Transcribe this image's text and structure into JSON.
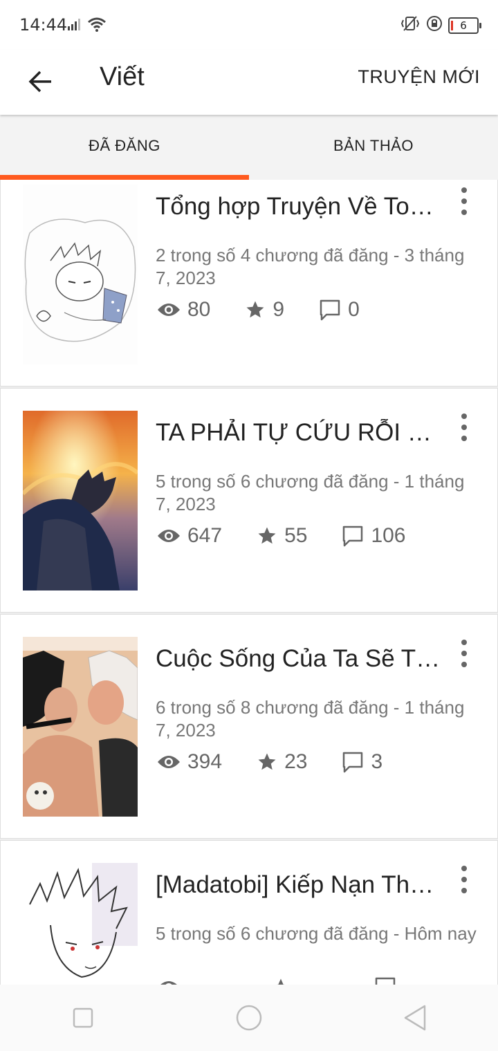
{
  "status_bar": {
    "time": "14:44",
    "battery": "6",
    "icons": [
      "signal-icon",
      "wifi-icon",
      "vibrate-icon",
      "rotation-lock-icon",
      "battery-icon"
    ]
  },
  "app_bar": {
    "title": "Viết",
    "new_story_label": "TRUYỆN MỚI"
  },
  "tabs": [
    {
      "label": "ĐÃ ĐĂNG",
      "active": true
    },
    {
      "label": "BẢN THẢO",
      "active": false
    }
  ],
  "accent_color": "#ff5a1f",
  "stories": [
    {
      "title": "Tổng hợp Truyện Về Tob…",
      "meta": "2 trong số 4 chương đã đăng - 3 tháng 7, 2023",
      "views": "80",
      "votes": "9",
      "comments": "0"
    },
    {
      "title": "TA PHẢI TỰ CỨU RỖI MÌ…",
      "meta": "5 trong số 6 chương đã đăng - 1 tháng 7, 2023",
      "views": "647",
      "votes": "55",
      "comments": "106"
    },
    {
      "title": "Cuộc Sống Của Ta Sẽ T…",
      "meta": "6 trong số 8 chương đã đăng - 1 tháng 7, 2023",
      "views": "394",
      "votes": "23",
      "comments": "3"
    },
    {
      "title": "[Madatobi] Kiếp Nạn Th…",
      "meta": "5 trong số 6 chương đã đăng - Hôm nay"
    }
  ]
}
